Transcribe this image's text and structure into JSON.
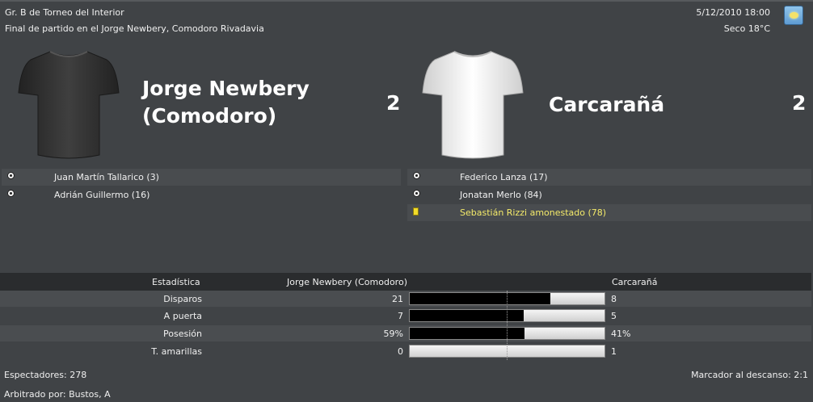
{
  "header": {
    "competition": "Gr. B de Torneo del Interior",
    "venue_line": "Final de partido en el Jorge Newbery, Comodoro Rivadavia",
    "datetime": "5/12/2010 18:00",
    "weather": "Seco 18°C",
    "weather_icon": "sunny-weather-icon"
  },
  "home": {
    "name": "Jorge Newbery (Comodoro)",
    "score": "2",
    "shirt_color": "#3a3a3a",
    "events": [
      {
        "type": "goal",
        "icon": "ball-icon",
        "text": "Juan Martín Tallarico (3)"
      },
      {
        "type": "goal",
        "icon": "ball-icon",
        "text": "Adrián Guillermo (16)"
      }
    ]
  },
  "away": {
    "name": "Carcarañá",
    "score": "2",
    "shirt_color": "#f0f0f0",
    "events": [
      {
        "type": "goal",
        "icon": "ball-icon",
        "text": "Federico Lanza (17)"
      },
      {
        "type": "goal",
        "icon": "ball-icon",
        "text": "Jonatan Merlo (84)"
      },
      {
        "type": "yellow",
        "icon": "yellow-card-icon",
        "text": "Sebastián Rizzi amonestado (78)"
      }
    ]
  },
  "stats": {
    "header": {
      "label": "Estadística",
      "home": "Jorge Newbery (Comodoro)",
      "away": "Carcarañá"
    },
    "rows": [
      {
        "label": "Disparos",
        "home": "21",
        "away": "8",
        "home_share": 0.724
      },
      {
        "label": "A puerta",
        "home": "7",
        "away": "5",
        "home_share": 0.583
      },
      {
        "label": "Posesión",
        "home": "59%",
        "away": "41%",
        "home_share": 0.59
      },
      {
        "label": "T. amarillas",
        "home": "0",
        "away": "1",
        "home_share": 0.0
      }
    ]
  },
  "footer": {
    "spectators": "Espectadores: 278",
    "referee": "Arbitrado por: Bustos, A",
    "halftime": "Marcador al descanso: 2:1"
  }
}
